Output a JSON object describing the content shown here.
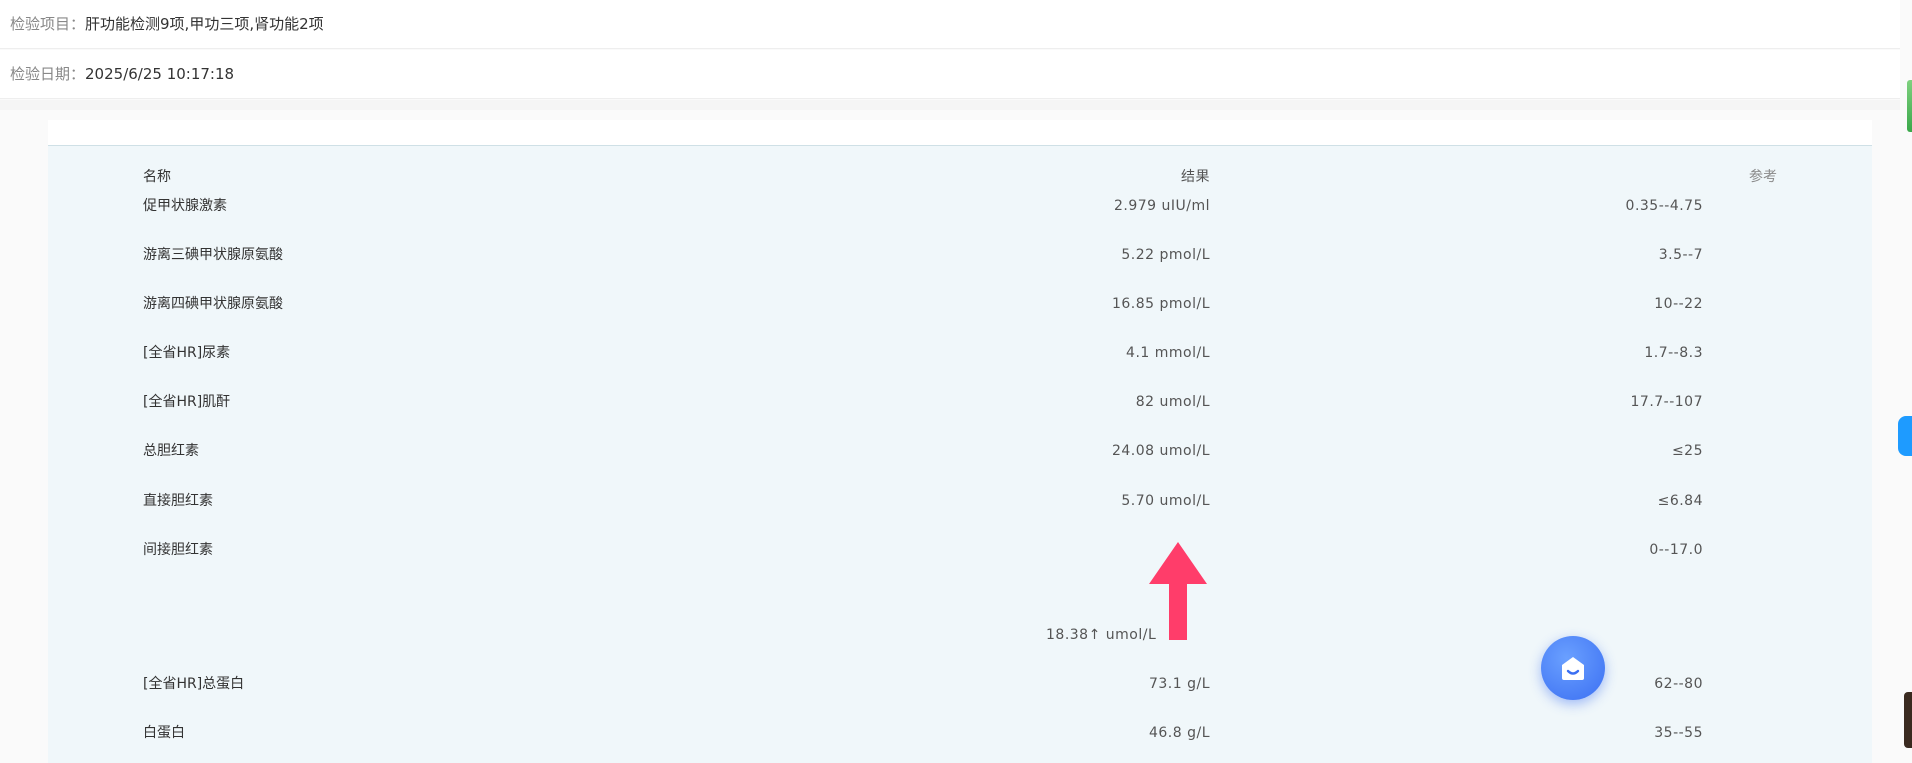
{
  "header": {
    "item_label": "检验项目：",
    "item_value": "肝功能检测9项,甲功三项,肾功能2项",
    "date_label": "检验日期：",
    "date_value": "2025/6/25 10:17:18"
  },
  "table": {
    "columns": {
      "name": "名称",
      "result": "结果",
      "reference": "参考"
    },
    "rows": [
      {
        "name": "促甲状腺激素",
        "result": "2.979 uIU/ml",
        "reference": "0.35--4.75"
      },
      {
        "name": "游离三碘甲状腺原氨酸",
        "result": "5.22 pmol/L",
        "reference": "3.5--7"
      },
      {
        "name": "游离四碘甲状腺原氨酸",
        "result": "16.85 pmol/L",
        "reference": "10--22"
      },
      {
        "name": "[全省HR]尿素",
        "result": "4.1 mmol/L",
        "reference": "1.7--8.3"
      },
      {
        "name": "[全省HR]肌酐",
        "result": "82 umol/L",
        "reference": "17.7--107"
      },
      {
        "name": "总胆红素",
        "result": "24.08 umol/L",
        "reference": "≤25"
      },
      {
        "name": "直接胆红素",
        "result": "5.70 umol/L",
        "reference": "≤6.84"
      },
      {
        "name": "间接胆红素",
        "result": "18.38↑ umol/L",
        "reference": "0--17.0"
      },
      {
        "name": "[全省HR]总蛋白",
        "result": "73.1 g/L",
        "reference": "62--80"
      },
      {
        "name": "白蛋白",
        "result": "46.8 g/L",
        "reference": "35--55"
      }
    ]
  },
  "icons": {
    "annotation": "red-up-arrow-icon",
    "fab": "home-icon"
  },
  "colors": {
    "arrow": "#ff3d6a",
    "fab": "#3b6ff2",
    "table_bg": "#f0f7fa"
  }
}
